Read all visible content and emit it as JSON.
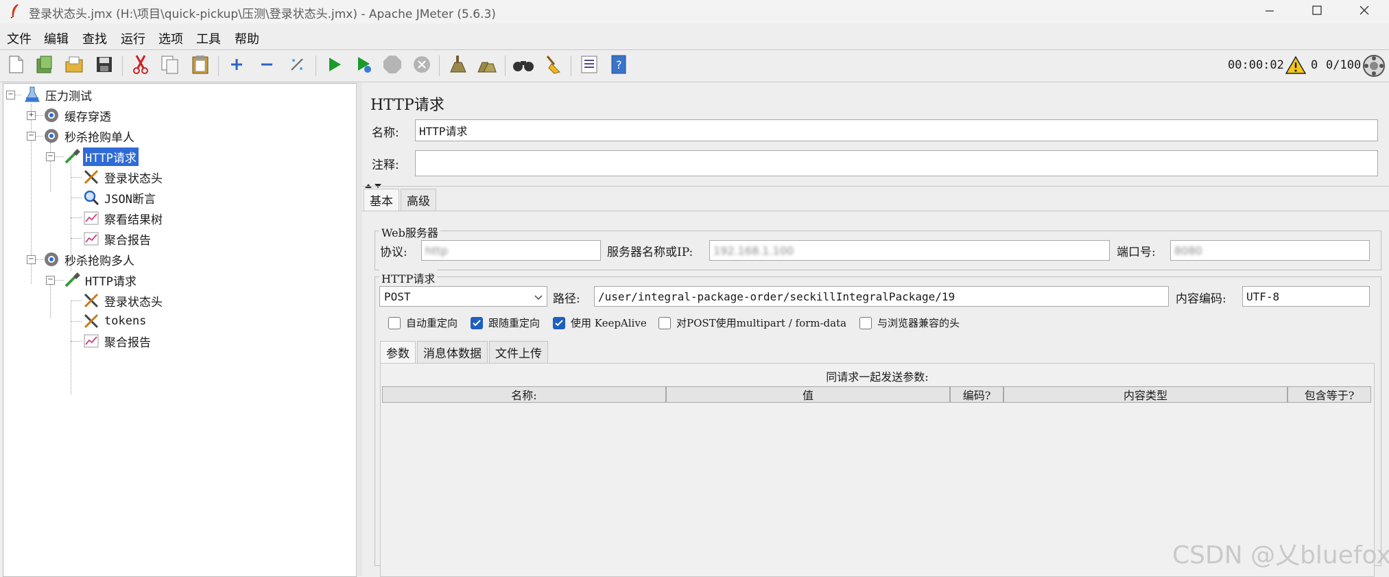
{
  "window": {
    "title": "登录状态头.jmx (H:\\项目\\quick-pickup\\压测\\登录状态头.jmx) - Apache JMeter (5.6.3)"
  },
  "menu": [
    "文件",
    "编辑",
    "查找",
    "运行",
    "选项",
    "工具",
    "帮助"
  ],
  "toolbar": {
    "icons": [
      "new-icon",
      "templates-icon",
      "open-icon",
      "save-icon",
      "cut-icon",
      "copy-icon",
      "paste-icon",
      "expand-icon",
      "collapse-icon",
      "toggle-icon",
      "start-icon",
      "start-no-pause-icon",
      "stop-icon",
      "shutdown-icon",
      "clear-icon",
      "clear-all-icon",
      "search-icon",
      "reset-search-icon",
      "function-helper-icon",
      "help-icon"
    ],
    "timer": "00:00:02",
    "warnings": "0",
    "threads": "0/100"
  },
  "tree": {
    "root": "压力测试",
    "nodes": [
      {
        "label": "缓存穿透",
        "icon": "thread-group-icon"
      },
      {
        "label": "秒杀抢购单人",
        "icon": "thread-group-icon"
      },
      {
        "label": "HTTP请求",
        "icon": "sampler-icon",
        "selected": true
      },
      {
        "label": "登录状态头",
        "icon": "config-tools-icon"
      },
      {
        "label": "JSON断言",
        "icon": "assertion-magnifier-icon"
      },
      {
        "label": "察看结果树",
        "icon": "listener-graph-icon"
      },
      {
        "label": "聚合报告",
        "icon": "listener-graph-icon"
      },
      {
        "label": "秒杀抢购多人",
        "icon": "thread-group-icon"
      },
      {
        "label": "HTTP请求",
        "icon": "sampler-icon"
      },
      {
        "label": "登录状态头",
        "icon": "config-tools-icon"
      },
      {
        "label": "tokens",
        "icon": "config-tools-icon"
      },
      {
        "label": "聚合报告",
        "icon": "listener-graph-icon"
      }
    ]
  },
  "panel": {
    "title": "HTTP请求",
    "name_label": "名称:",
    "name_value": "HTTP请求",
    "comment_label": "注释:",
    "comment_value": "",
    "tabs": [
      "基本",
      "高级"
    ],
    "web_server": {
      "legend": "Web服务器",
      "protocol_label": "协议:",
      "protocol_value": "http",
      "server_label": "服务器名称或IP:",
      "server_value": "192.168.1.100",
      "port_label": "端口号:",
      "port_value": "8080"
    },
    "http_request": {
      "legend": "HTTP请求",
      "method": "POST",
      "path_label": "路径:",
      "path_value": "/user/integral-package-order/seckillIntegralPackage/19",
      "encoding_label": "内容编码:",
      "encoding_value": "UTF-8"
    },
    "checkboxes": [
      {
        "label": "自动重定向",
        "checked": false
      },
      {
        "label": "跟随重定向",
        "checked": true
      },
      {
        "label": "使用 KeepAlive",
        "checked": true
      },
      {
        "label": "对POST使用multipart / form-data",
        "checked": false
      },
      {
        "label": "与浏览器兼容的头",
        "checked": false
      }
    ],
    "sub_tabs": [
      "参数",
      "消息体数据",
      "文件上传"
    ],
    "params": {
      "caption": "同请求一起发送参数:",
      "columns": [
        "名称:",
        "值",
        "编码?",
        "内容类型",
        "包含等于?"
      ]
    }
  },
  "watermark": "CSDN @乂bluefox"
}
